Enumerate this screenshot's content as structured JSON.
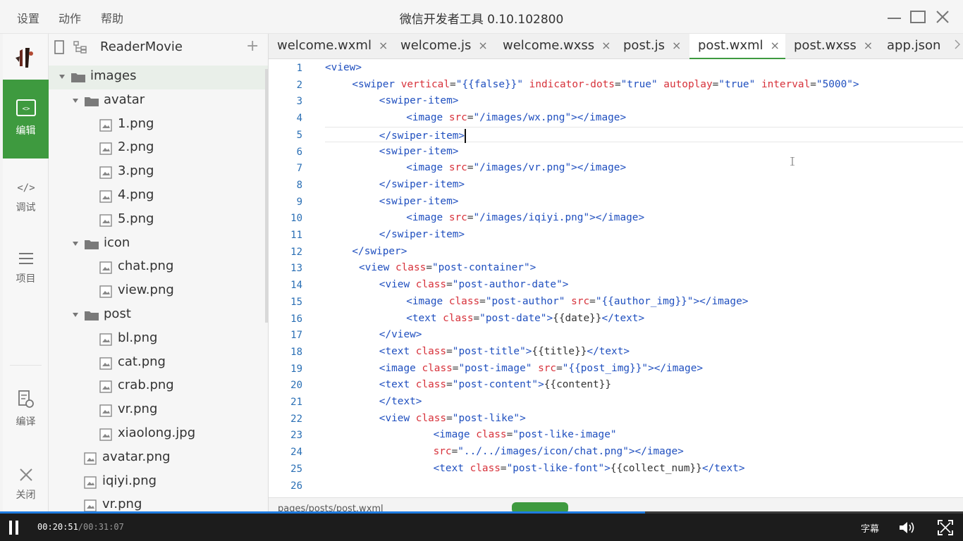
{
  "menu": {
    "settings": "设置",
    "actions": "动作",
    "help": "帮助"
  },
  "window": {
    "title": "微信开发者工具 0.10.102800"
  },
  "activity": {
    "edit_label": "编辑",
    "debug_label": "调试",
    "project_label": "项目",
    "compile_label": "编译",
    "close_label": "关闭",
    "colors": {
      "active_bg": "#3e9a3f"
    }
  },
  "explorer": {
    "project_name": "ReaderMovie",
    "add_symbol": "+",
    "items": [
      {
        "label": "images",
        "type": "folder",
        "depth": 0,
        "expanded": true
      },
      {
        "label": "avatar",
        "type": "folder",
        "depth": 1,
        "expanded": true
      },
      {
        "label": "1.png",
        "type": "file",
        "depth": 2
      },
      {
        "label": "2.png",
        "type": "file",
        "depth": 2
      },
      {
        "label": "3.png",
        "type": "file",
        "depth": 2
      },
      {
        "label": "4.png",
        "type": "file",
        "depth": 2
      },
      {
        "label": "5.png",
        "type": "file",
        "depth": 2
      },
      {
        "label": "icon",
        "type": "folder",
        "depth": 1,
        "expanded": true
      },
      {
        "label": "chat.png",
        "type": "file",
        "depth": 2
      },
      {
        "label": "view.png",
        "type": "file",
        "depth": 2
      },
      {
        "label": "post",
        "type": "folder",
        "depth": 1,
        "expanded": true
      },
      {
        "label": "bl.png",
        "type": "file",
        "depth": 2
      },
      {
        "label": "cat.png",
        "type": "file",
        "depth": 2
      },
      {
        "label": "crab.png",
        "type": "file",
        "depth": 2
      },
      {
        "label": "vr.png",
        "type": "file",
        "depth": 2
      },
      {
        "label": "xiaolong.jpg",
        "type": "file",
        "depth": 2
      },
      {
        "label": "avatar.png",
        "type": "file",
        "depth": 1
      },
      {
        "label": "iqiyi.png",
        "type": "file",
        "depth": 1
      },
      {
        "label": "vr.png",
        "type": "file",
        "depth": 1
      }
    ]
  },
  "tabs": [
    {
      "label": "welcome.wxml",
      "active": false
    },
    {
      "label": "welcome.js",
      "active": false
    },
    {
      "label": "welcome.wxss",
      "active": false
    },
    {
      "label": "post.js",
      "active": false
    },
    {
      "label": "post.wxml",
      "active": true
    },
    {
      "label": "post.wxss",
      "active": false
    },
    {
      "label": "app.json",
      "active": false
    }
  ],
  "tab_close_symbol": "×",
  "editor": {
    "current_line": 5,
    "lines": [
      {
        "n": "1",
        "indent": 0,
        "parts": [
          [
            "t",
            "<view>"
          ]
        ]
      },
      {
        "n": "2",
        "indent": 1,
        "parts": [
          [
            "t",
            "<swiper "
          ],
          [
            "a",
            "vertical"
          ],
          [
            "p",
            "="
          ],
          [
            "s",
            "\"{{false}}\""
          ],
          [
            "p",
            " "
          ],
          [
            "a",
            "indicator-dots"
          ],
          [
            "p",
            "="
          ],
          [
            "s",
            "\"true\""
          ],
          [
            "p",
            " "
          ],
          [
            "a",
            "autoplay"
          ],
          [
            "p",
            "="
          ],
          [
            "s",
            "\"true\""
          ],
          [
            "p",
            " "
          ],
          [
            "a",
            "interval"
          ],
          [
            "p",
            "="
          ],
          [
            "s",
            "\"5000\""
          ],
          [
            "t",
            ">"
          ]
        ]
      },
      {
        "n": "3",
        "indent": 2,
        "parts": [
          [
            "t",
            "<swiper-item>"
          ]
        ]
      },
      {
        "n": "4",
        "indent": 3,
        "parts": [
          [
            "t",
            "<image "
          ],
          [
            "a",
            "src"
          ],
          [
            "p",
            "="
          ],
          [
            "s",
            "\"/images/wx.png\""
          ],
          [
            "t",
            "></image>"
          ]
        ]
      },
      {
        "n": "5",
        "indent": 2,
        "parts": [
          [
            "t",
            "</swiper-item>"
          ]
        ]
      },
      {
        "n": "6",
        "indent": 2,
        "parts": [
          [
            "t",
            "<swiper-item>"
          ]
        ]
      },
      {
        "n": "7",
        "indent": 3,
        "parts": [
          [
            "t",
            "<image "
          ],
          [
            "a",
            "src"
          ],
          [
            "p",
            "="
          ],
          [
            "s",
            "\"/images/vr.png\""
          ],
          [
            "t",
            "></image>"
          ]
        ]
      },
      {
        "n": "8",
        "indent": 2,
        "parts": [
          [
            "t",
            "</swiper-item>"
          ]
        ]
      },
      {
        "n": "9",
        "indent": 2,
        "parts": [
          [
            "t",
            "<swiper-item>"
          ]
        ]
      },
      {
        "n": "10",
        "indent": 3,
        "parts": [
          [
            "t",
            "<image "
          ],
          [
            "a",
            "src"
          ],
          [
            "p",
            "="
          ],
          [
            "s",
            "\"/images/iqiyi.png\""
          ],
          [
            "t",
            "></image>"
          ]
        ]
      },
      {
        "n": "11",
        "indent": 2,
        "parts": [
          [
            "t",
            "</swiper-item>"
          ]
        ]
      },
      {
        "n": "12",
        "indent": 1,
        "parts": [
          [
            "t",
            "</swiper>"
          ]
        ]
      },
      {
        "n": "13",
        "indent": 1.25,
        "parts": [
          [
            "t",
            "<view "
          ],
          [
            "a",
            "class"
          ],
          [
            "p",
            "="
          ],
          [
            "s",
            "\"post-container\""
          ],
          [
            "t",
            ">"
          ]
        ]
      },
      {
        "n": "14",
        "indent": 2,
        "parts": [
          [
            "t",
            "<view "
          ],
          [
            "a",
            "class"
          ],
          [
            "p",
            "="
          ],
          [
            "s",
            "\"post-author-date\""
          ],
          [
            "t",
            ">"
          ]
        ]
      },
      {
        "n": "15",
        "indent": 3,
        "parts": [
          [
            "t",
            "<image "
          ],
          [
            "a",
            "class"
          ],
          [
            "p",
            "="
          ],
          [
            "s",
            "\"post-author\""
          ],
          [
            "p",
            " "
          ],
          [
            "a",
            "src"
          ],
          [
            "p",
            "="
          ],
          [
            "s",
            "\"{{author_img}}\""
          ],
          [
            "t",
            "></image>"
          ]
        ]
      },
      {
        "n": "16",
        "indent": 3,
        "parts": [
          [
            "t",
            "<text "
          ],
          [
            "a",
            "class"
          ],
          [
            "p",
            "="
          ],
          [
            "s",
            "\"post-date\""
          ],
          [
            "t",
            ">"
          ],
          [
            "p",
            "{{date}}"
          ],
          [
            "t",
            "</text>"
          ]
        ]
      },
      {
        "n": "17",
        "indent": 2,
        "parts": [
          [
            "t",
            "</view>"
          ]
        ]
      },
      {
        "n": "18",
        "indent": 2,
        "parts": [
          [
            "t",
            "<text "
          ],
          [
            "a",
            "class"
          ],
          [
            "p",
            "="
          ],
          [
            "s",
            "\"post-title\""
          ],
          [
            "t",
            ">"
          ],
          [
            "p",
            "{{title}}"
          ],
          [
            "t",
            "</text>"
          ]
        ]
      },
      {
        "n": "19",
        "indent": 2,
        "parts": [
          [
            "t",
            "<image "
          ],
          [
            "a",
            "class"
          ],
          [
            "p",
            "="
          ],
          [
            "s",
            "\"post-image\""
          ],
          [
            "p",
            " "
          ],
          [
            "a",
            "src"
          ],
          [
            "p",
            "="
          ],
          [
            "s",
            "\"{{post_img}}\""
          ],
          [
            "t",
            "></image>"
          ]
        ]
      },
      {
        "n": "20",
        "indent": 2,
        "parts": [
          [
            "t",
            "<text "
          ],
          [
            "a",
            "class"
          ],
          [
            "p",
            "="
          ],
          [
            "s",
            "\"post-content\""
          ],
          [
            "t",
            ">"
          ],
          [
            "p",
            "{{content}}"
          ]
        ]
      },
      {
        "n": "21",
        "indent": 2,
        "parts": [
          [
            "t",
            "</text>"
          ]
        ]
      },
      {
        "n": "22",
        "indent": 2,
        "parts": [
          [
            "t",
            "<view "
          ],
          [
            "a",
            "class"
          ],
          [
            "p",
            "="
          ],
          [
            "s",
            "\"post-like\""
          ],
          [
            "t",
            ">"
          ]
        ]
      },
      {
        "n": "23",
        "indent": 4,
        "parts": [
          [
            "t",
            "<image "
          ],
          [
            "a",
            "class"
          ],
          [
            "p",
            "="
          ],
          [
            "s",
            "\"post-like-image\""
          ]
        ]
      },
      {
        "n": "24",
        "indent": 4,
        "parts": [
          [
            "a",
            "src"
          ],
          [
            "p",
            "="
          ],
          [
            "s",
            "\"../../images/icon/chat.png\""
          ],
          [
            "t",
            "></image>"
          ]
        ]
      },
      {
        "n": "25",
        "indent": 4,
        "parts": [
          [
            "t",
            "<text "
          ],
          [
            "a",
            "class"
          ],
          [
            "p",
            "="
          ],
          [
            "s",
            "\"post-like-font\""
          ],
          [
            "t",
            ">"
          ],
          [
            "p",
            "{{collect_num}}"
          ],
          [
            "t",
            "</text>"
          ]
        ]
      },
      {
        "n": "26",
        "indent": 0,
        "parts": []
      }
    ]
  },
  "status": {
    "path": "pages/posts/post.wxml"
  },
  "player": {
    "current_time": "00:20:51",
    "duration": "/00:31:07",
    "progress": 0.67,
    "subtitle_label": "字幕"
  }
}
